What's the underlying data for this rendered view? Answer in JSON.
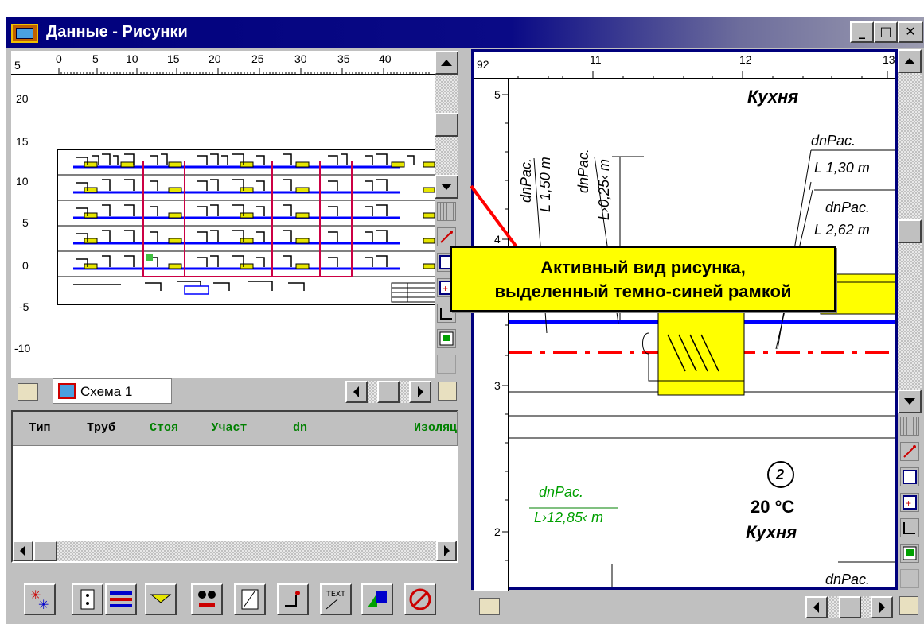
{
  "window": {
    "title": "Данные - Рисунки",
    "min": "_",
    "max": "□",
    "close": "✕"
  },
  "left_pane": {
    "ruler_x": [
      "5",
      "0",
      "5",
      "10",
      "15",
      "20",
      "25",
      "30",
      "35",
      "40"
    ],
    "ruler_y": [
      "20",
      "15",
      "10",
      "5",
      "0",
      "-5",
      "-10"
    ],
    "sheet_tab": "Схема 1"
  },
  "grid": {
    "columns": [
      "Тип",
      "Труб",
      "Стоя",
      "Участ",
      "dn",
      "Изоляц"
    ]
  },
  "right_pane": {
    "ruler_x": [
      "92",
      "11",
      "12",
      "13"
    ],
    "ruler_y": [
      "5",
      "4",
      "3",
      "2"
    ],
    "room_top": "Кухня",
    "labels": {
      "dnpac": "dnPac.",
      "l130": "L 1,30 m",
      "l262": "L 2,62 m",
      "l150": "L 1,50 m",
      "l025": "L›0,25‹ m",
      "l1285": "L›12,85‹ m",
      "circle": "2",
      "temp": "20 °C",
      "room_bottom": "Кухня"
    }
  },
  "callout": {
    "line1": "Активный вид рисунка,",
    "line2": "выделенный темно-синей рамкой"
  },
  "colors": {
    "accent": "#00007c",
    "callout": "#ffff00",
    "pipe_blue": "#0000ff",
    "pipe_red": "#ff0000",
    "green_text": "#00a000"
  }
}
